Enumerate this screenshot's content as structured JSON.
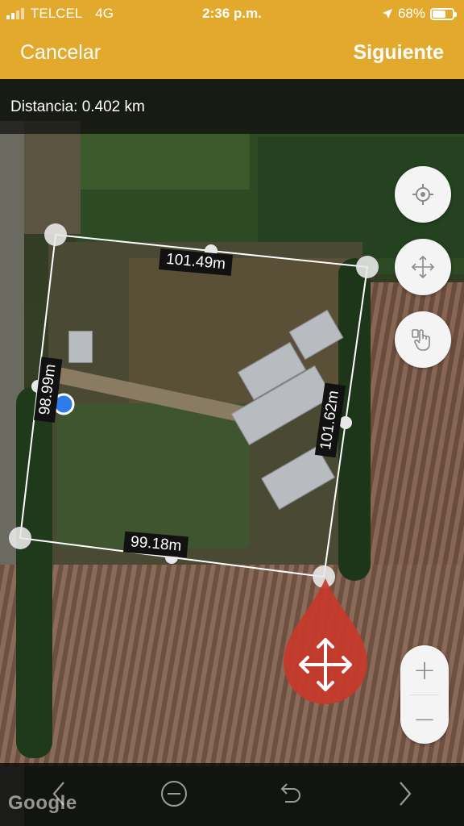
{
  "status_bar": {
    "carrier": "TELCEL",
    "network": "4G",
    "time": "2:36 p.m.",
    "battery": "68%",
    "battery_level": 0.68,
    "location_icon": "location-arrow-icon"
  },
  "nav": {
    "cancel_label": "Cancelar",
    "next_label": "Siguiente"
  },
  "distance": {
    "text": "Distancia: 0.402 km"
  },
  "segments": {
    "top": "101.49m",
    "right": "101.62m",
    "bottom": "99.18m",
    "left": "98.99m"
  },
  "controls": {
    "locate_icon": "crosshair-icon",
    "pan_icon": "move-arrows-icon",
    "touch_icon": "hand-pointer-icon",
    "drag_icon": "move-arrows-icon",
    "zoom_in_label": "+",
    "zoom_out_label": "−"
  },
  "toolbar": {
    "prev_icon": "chevron-left-icon",
    "remove_icon": "minus-circle-icon",
    "undo_icon": "undo-icon",
    "next_icon": "chevron-right-icon"
  },
  "attribution": "Google",
  "colors": {
    "accent": "#e3a92d",
    "drag_pin": "#c83a2a",
    "active_point": "#2f7be8"
  }
}
